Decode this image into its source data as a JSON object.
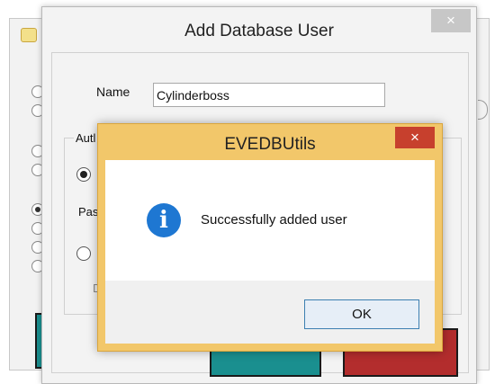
{
  "add_user_dialog": {
    "title": "Add Database User",
    "close_glyph": "×",
    "name_label": "Name",
    "name_value": "Cylinderboss",
    "auth_group_label_partial": "Autl",
    "password_label_partial": "Pas",
    "disabled_label_partial": "D"
  },
  "message_box": {
    "title": "EVEDBUtils",
    "close_glyph": "×",
    "message": "Successfully added user",
    "info_glyph": "i",
    "ok_label": "OK"
  },
  "colors": {
    "message_frame": "#f2c76a",
    "close_red": "#c7402d",
    "info_blue": "#1e77d2",
    "teal_button": "#1a8f8f",
    "red_button": "#b32d2d"
  },
  "icons": [
    "app-icon",
    "close-icon",
    "info-icon"
  ]
}
